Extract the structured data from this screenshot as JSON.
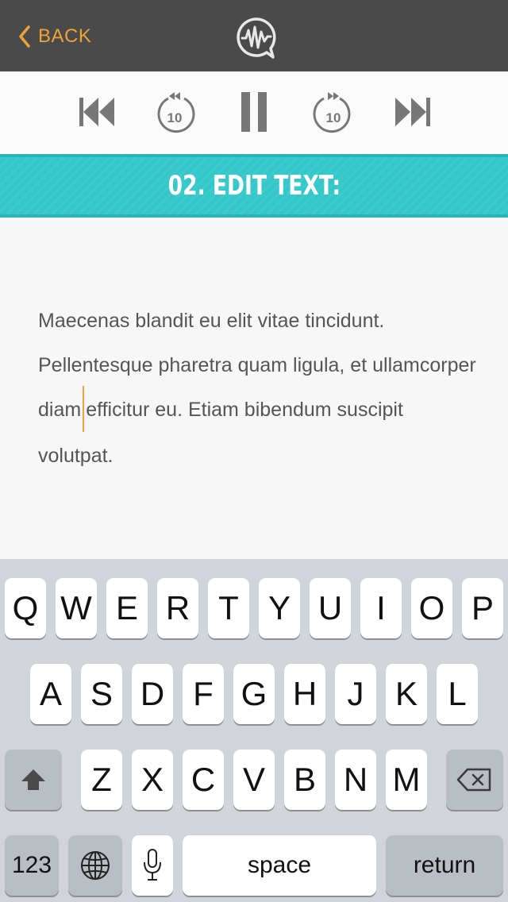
{
  "header": {
    "back_label": "BACK",
    "logo_icon": "waveform-speech-bubble-icon",
    "accent_color": "#f0a23a",
    "background_color": "#4a4a4a"
  },
  "player": {
    "controls": [
      {
        "name": "skip-back-icon"
      },
      {
        "name": "rewind-10-icon",
        "label": "10"
      },
      {
        "name": "pause-icon"
      },
      {
        "name": "forward-10-icon",
        "label": "10"
      },
      {
        "name": "skip-forward-icon"
      }
    ]
  },
  "section": {
    "title": "02. EDIT TEXT:",
    "color": "#35c8cb"
  },
  "editor": {
    "text_before_caret": "Maecenas blandit eu elit vitae tincidunt. Pellentesque pharetra quam ligula, et ullamcorper diam",
    "text_after_caret": "efficitur eu. Etiam bibendum suscipit volutpat."
  },
  "keyboard": {
    "row1": [
      "Q",
      "W",
      "E",
      "R",
      "T",
      "Y",
      "U",
      "I",
      "O",
      "P"
    ],
    "row2": [
      "A",
      "S",
      "D",
      "F",
      "G",
      "H",
      "J",
      "K",
      "L"
    ],
    "row3": [
      "Z",
      "X",
      "C",
      "V",
      "B",
      "N",
      "M"
    ],
    "numbers_label": "123",
    "space_label": "space",
    "return_label": "return",
    "shift_icon": "shift-arrow-icon",
    "delete_icon": "backspace-icon",
    "globe_icon": "globe-icon",
    "mic_icon": "microphone-icon"
  }
}
